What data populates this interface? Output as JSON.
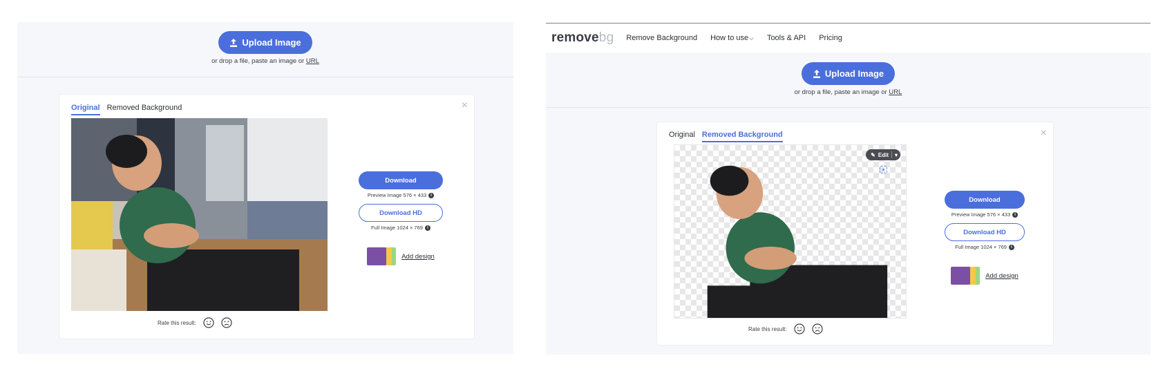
{
  "upload": {
    "button_label": "Upload Image",
    "hint_prefix": "or drop a file, paste an image or",
    "hint_link": "URL"
  },
  "nav": {
    "logo_main": "remove",
    "logo_suffix": "bg",
    "links": [
      "Remove Background",
      "How to use",
      "Tools & API",
      "Pricing"
    ]
  },
  "tabs": {
    "original": "Original",
    "removed": "Removed Background"
  },
  "close_glyph": "×",
  "edit_label": "Edit",
  "actions": {
    "download": "Download",
    "preview_meta": "Preview Image 576 × 433",
    "download_hd": "Download HD",
    "full_meta": "Full Image 1024 × 769",
    "add_design": "Add design"
  },
  "rating": {
    "label": "Rate this result:"
  },
  "colors": {
    "accent": "#4a6fdc",
    "panel_bg": "#f6f7fb"
  },
  "icons": [
    "upload-icon",
    "close-icon",
    "info-icon",
    "happy-face-icon",
    "sad-face-icon",
    "edit-pencil-icon",
    "caret-down-icon",
    "focus-icon",
    "chevron-down-icon"
  ]
}
